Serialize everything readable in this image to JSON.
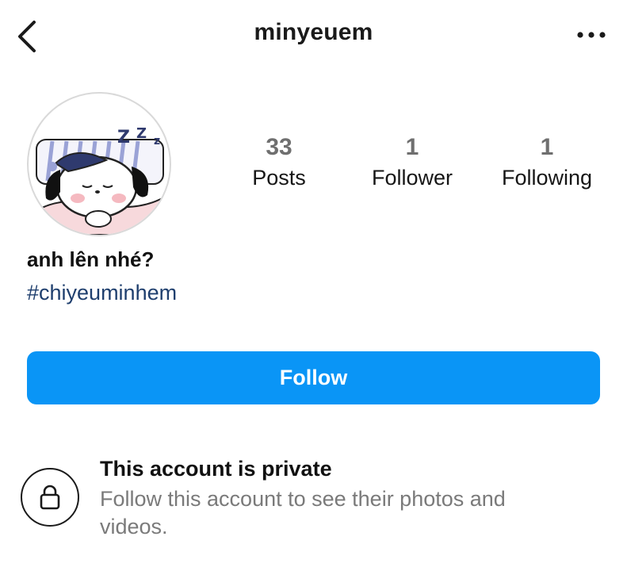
{
  "header": {
    "username": "minyeuem",
    "back_icon": "chevron-left-icon",
    "more_icon": "more-horizontal-icon"
  },
  "profile": {
    "avatar_icon": "sleeping-dog-avatar",
    "stats": [
      {
        "value": "33",
        "label": "Posts"
      },
      {
        "value": "1",
        "label": "Follower"
      },
      {
        "value": "1",
        "label": "Following"
      }
    ],
    "bio_name": "anh lên nhé?",
    "bio_hashtag": "#chiyeuminhem"
  },
  "actions": {
    "follow_label": "Follow"
  },
  "private_notice": {
    "icon": "lock-icon",
    "title": "This account is private",
    "description": "Follow this account to see their photos and videos."
  },
  "colors": {
    "accent": "#0a95f6",
    "hashtag": "#1f3f6e",
    "muted": "#7a7a7a"
  }
}
